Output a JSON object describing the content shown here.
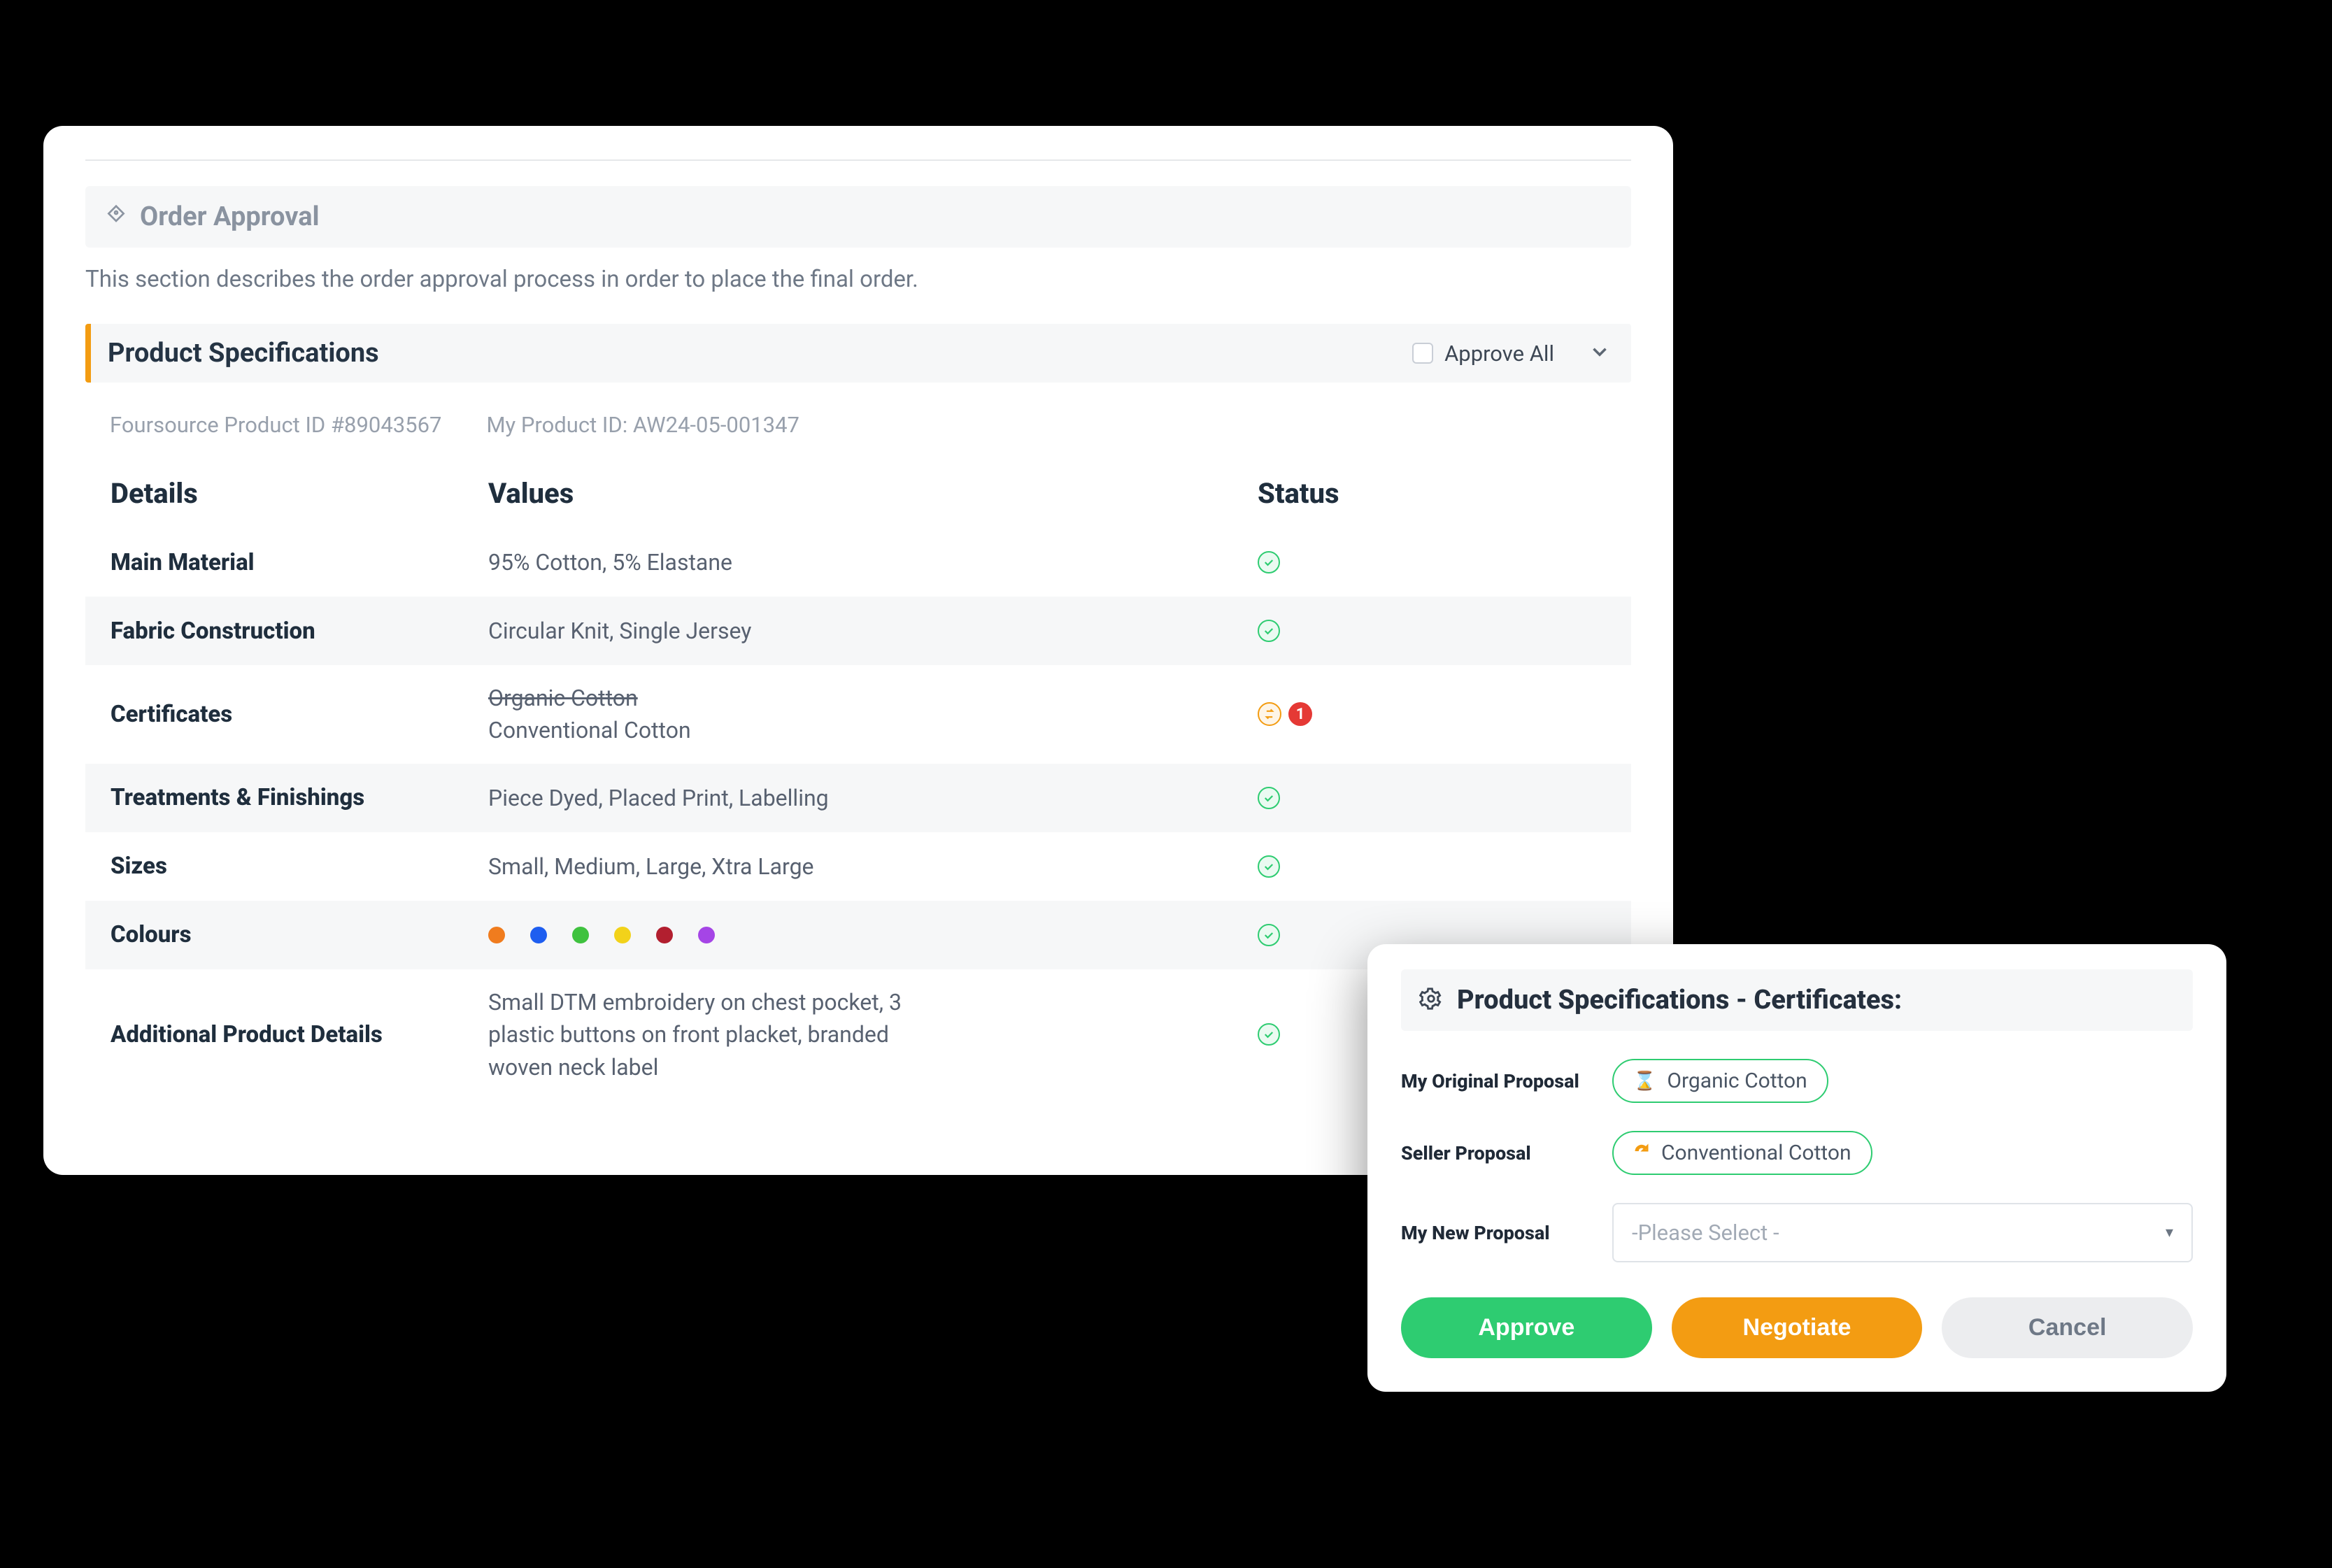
{
  "header": {
    "title": "Order Approval",
    "description": "This section describes the order approval process in order to place the final order."
  },
  "spec_bar": {
    "title": "Product Specifications",
    "approve_all_label": "Approve All"
  },
  "ids": {
    "foursource": "Foursource Product ID #89043567",
    "my": "My Product ID: AW24-05-001347"
  },
  "columns": {
    "details": "Details",
    "values": "Values",
    "status": "Status"
  },
  "rows": {
    "main_material": {
      "label": "Main Material",
      "value": "95% Cotton, 5% Elastane"
    },
    "fabric_construction": {
      "label": "Fabric Construction",
      "value": "Circular Knit, Single Jersey"
    },
    "certificates": {
      "label": "Certificates",
      "strike": "Organic Cotton",
      "current": "Conventional Cotton",
      "badge_count": "1"
    },
    "treatments": {
      "label": "Treatments & Finishings",
      "value": "Piece Dyed, Placed Print, Labelling"
    },
    "sizes": {
      "label": "Sizes",
      "value": "Small, Medium, Large, Xtra Large"
    },
    "colours": {
      "label": "Colours"
    },
    "additional": {
      "label": "Additional Product Details",
      "value": "Small DTM embroidery on chest pocket, 3 plastic buttons on front placket, branded woven neck label"
    }
  },
  "colours": [
    "#f07c1e",
    "#1e5ef0",
    "#3fc23f",
    "#f2d21a",
    "#b21f2f",
    "#a545e6"
  ],
  "popup": {
    "title": "Product Specifications - Certificates:",
    "original_label": "My Original Proposal",
    "original_value": "Organic Cotton",
    "seller_label": "Seller Proposal",
    "seller_value": "Conventional Cotton",
    "new_label": "My New Proposal",
    "select_placeholder": "-Please Select -",
    "approve": "Approve",
    "negotiate": "Negotiate",
    "cancel": "Cancel"
  }
}
